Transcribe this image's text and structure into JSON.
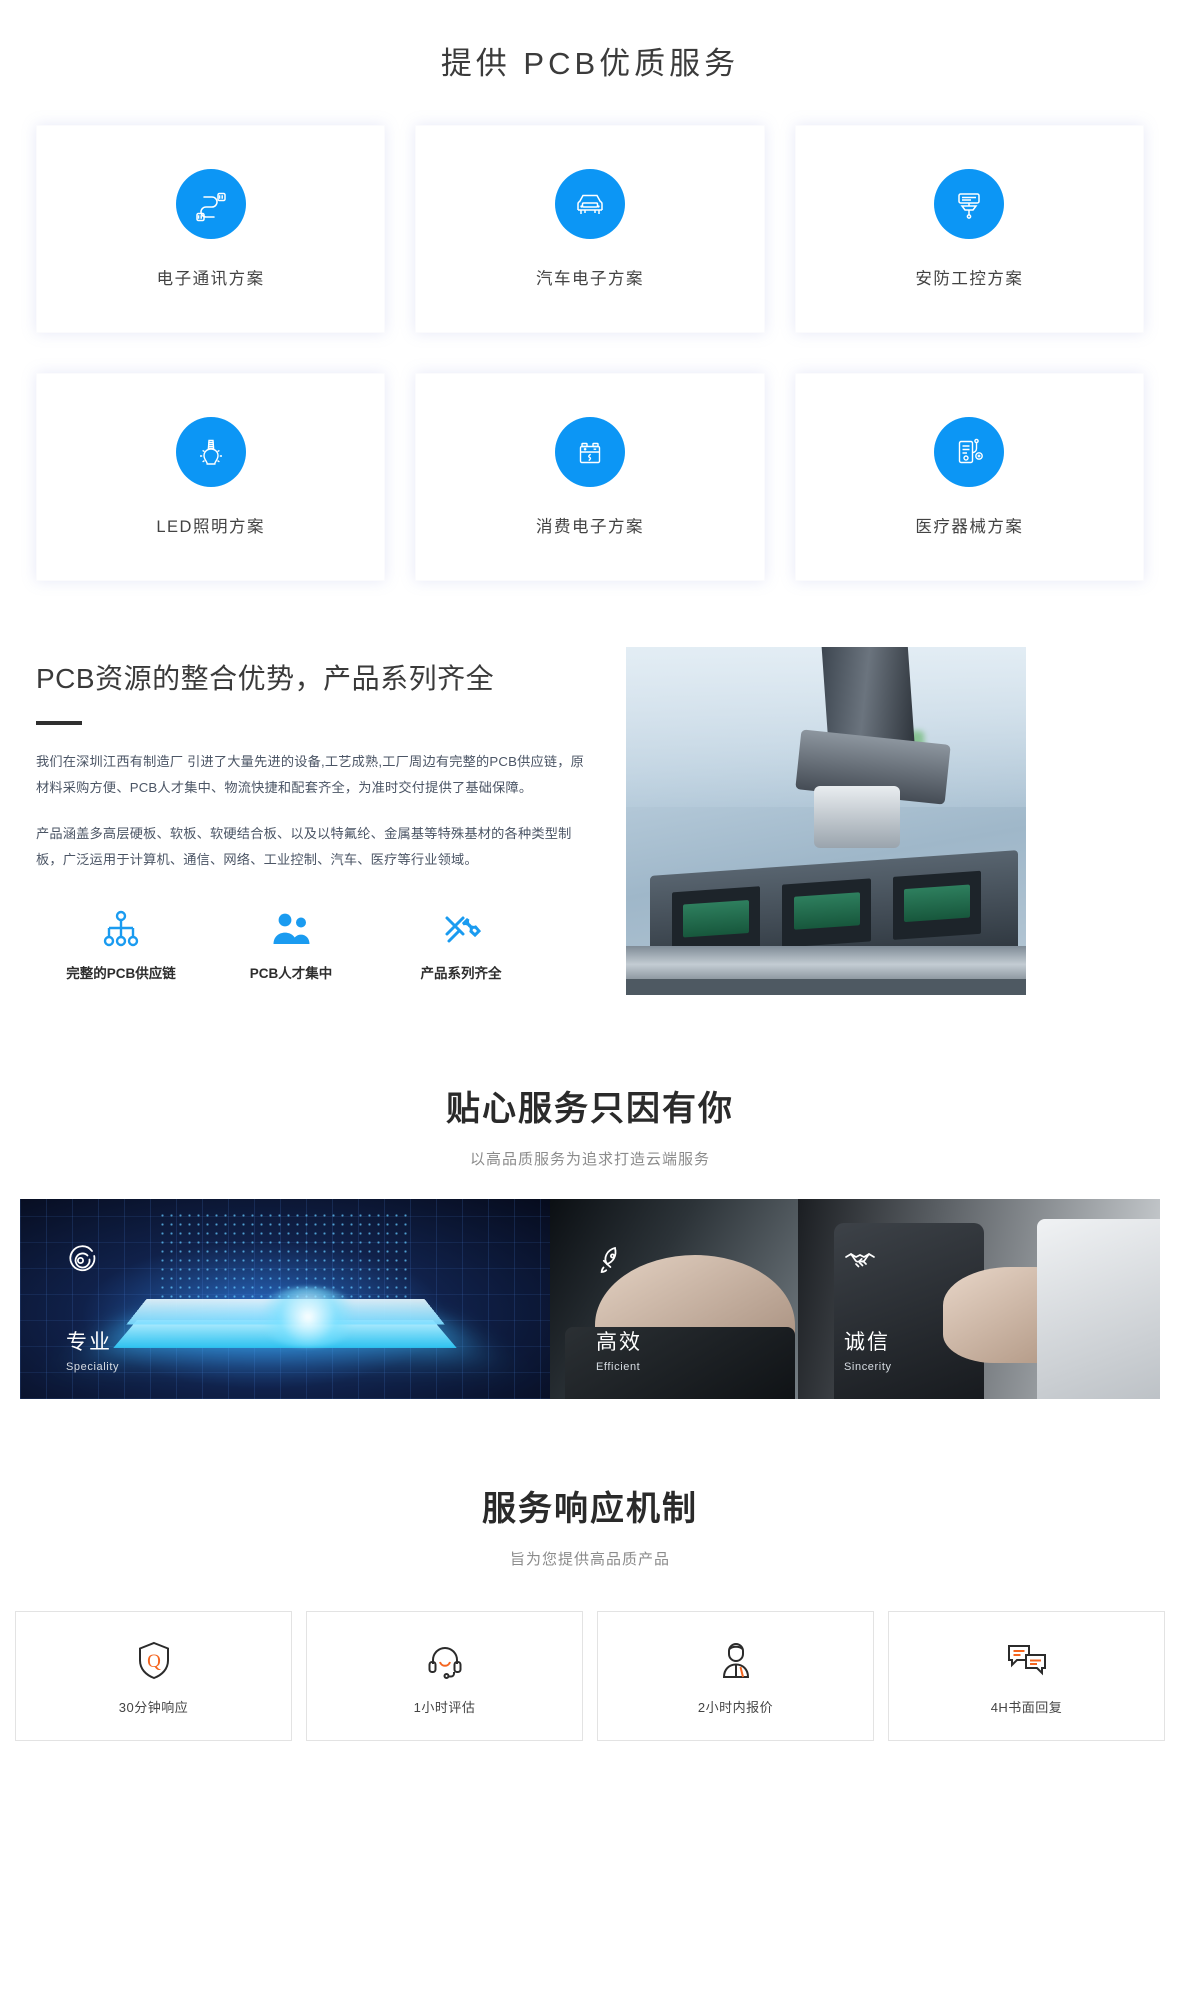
{
  "solutions": {
    "title": "提供 PCB优质服务",
    "cards": [
      {
        "label": "电子通讯方案",
        "icon": "cable-icon"
      },
      {
        "label": "汽车电子方案",
        "icon": "car-icon"
      },
      {
        "label": "安防工控方案",
        "icon": "surveillance-camera-icon"
      },
      {
        "label": "LED照明方案",
        "icon": "light-bulb-icon"
      },
      {
        "label": "消费电子方案",
        "icon": "battery-icon"
      },
      {
        "label": "医疗器械方案",
        "icon": "medical-device-icon"
      }
    ],
    "accent_color": "#0c96f5"
  },
  "advantage": {
    "heading": "PCB资源的整合优势，产品系列齐全",
    "paragraph1": "我们在深圳江西有制造厂 引进了大量先进的设备,工艺成熟,工厂周边有完整的PCB供应链，原材料采购方便、PCB人才集中、物流快捷和配套齐全，为准时交付提供了基础保障。",
    "paragraph2": "产品涵盖多高层硬板、软板、软硬结合板、以及以特氟纶、金属基等特殊基材的各种类型制板，广泛运用于计算机、通信、网络、工业控制、汽车、医疗等行业领域。",
    "features": [
      {
        "label": "完整的PCB供应链",
        "icon": "sitemap-icon"
      },
      {
        "label": "PCB人才集中",
        "icon": "people-icon"
      },
      {
        "label": "产品系列齐全",
        "icon": "tools-icon"
      }
    ],
    "image_alt": "robot-arm-pcb-assembly-photo"
  },
  "caring": {
    "heading": "贴心服务只因有你",
    "subheading": "以高品质服务为追求打造云端服务",
    "panels": [
      {
        "cn": "专业",
        "en": "Speciality",
        "icon": "target-icon"
      },
      {
        "cn": "高效",
        "en": "Efficient",
        "icon": "rocket-icon"
      },
      {
        "cn": "诚信",
        "en": "Sincerity",
        "icon": "handshake-icon"
      }
    ]
  },
  "response": {
    "heading": "服务响应机制",
    "subheading": "旨为您提供高品质产品",
    "cards": [
      {
        "label": "30分钟响应",
        "icon": "shield-q-icon"
      },
      {
        "label": "1小时评估",
        "icon": "headset-icon"
      },
      {
        "label": "2小时内报价",
        "icon": "agent-person-icon"
      },
      {
        "label": "4H书面回复",
        "icon": "chat-bubbles-icon"
      }
    ],
    "accent_color": "#f4651f"
  }
}
